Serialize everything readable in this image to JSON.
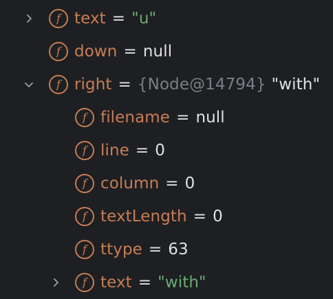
{
  "variables": [
    {
      "name": "text",
      "value": "\"u\"",
      "value_type": "string",
      "expanded": false,
      "has_children": true
    },
    {
      "name": "down",
      "value": "null",
      "value_type": "null",
      "has_children": false
    },
    {
      "name": "right",
      "ref": "{Node@14794}",
      "value": "\"with\"",
      "expanded": true,
      "has_children": true,
      "children": [
        {
          "name": "filename",
          "value": "null",
          "value_type": "null"
        },
        {
          "name": "line",
          "value": "0",
          "value_type": "number"
        },
        {
          "name": "column",
          "value": "0",
          "value_type": "number"
        },
        {
          "name": "textLength",
          "value": "0",
          "value_type": "number"
        },
        {
          "name": "ttype",
          "value": "63",
          "value_type": "number"
        },
        {
          "name": "text",
          "value": "\"with\"",
          "value_type": "string",
          "expanded": false,
          "has_children": true
        }
      ]
    }
  ],
  "labels": {
    "equals": "=",
    "field_icon_letter": "f"
  },
  "colors": {
    "background": "#1e1f22",
    "field_name": "#c77d55",
    "string_value": "#6aab73",
    "ref_value": "#7a7e85",
    "plain_value": "#dfe1e5",
    "chevron": "#9da0a8"
  }
}
